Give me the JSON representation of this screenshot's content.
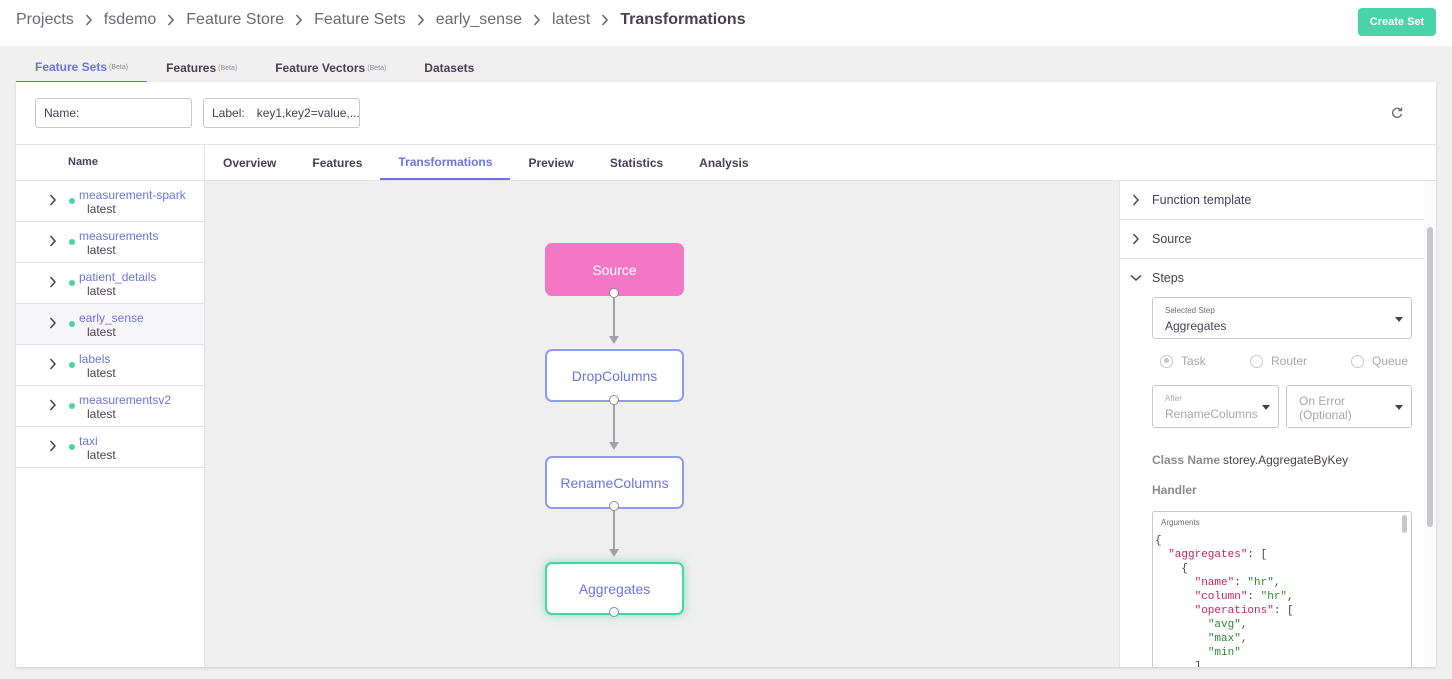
{
  "breadcrumbs": [
    "Projects",
    "fsdemo",
    "Feature Store",
    "Feature Sets",
    "early_sense",
    "latest",
    "Transformations"
  ],
  "header": {
    "create_label": "Create Set"
  },
  "top_tabs": [
    {
      "label": "Feature Sets",
      "beta": "(Beta)"
    },
    {
      "label": "Features",
      "beta": "(Beta)"
    },
    {
      "label": "Feature Vectors",
      "beta": "(Beta)"
    },
    {
      "label": "Datasets",
      "beta": ""
    }
  ],
  "filters": {
    "name_label": "Name:",
    "label_label": "Label:",
    "label_placeholder": "key1,key2=value,..."
  },
  "table": {
    "header": "Name",
    "rows": [
      {
        "name": "measurement-spark",
        "tag": "latest"
      },
      {
        "name": "measurements",
        "tag": "latest"
      },
      {
        "name": "patient_details",
        "tag": "latest"
      },
      {
        "name": "early_sense",
        "tag": "latest"
      },
      {
        "name": "labels",
        "tag": "latest"
      },
      {
        "name": "measurementsv2",
        "tag": "latest"
      },
      {
        "name": "taxi",
        "tag": "latest"
      }
    ]
  },
  "inner_tabs": [
    "Overview",
    "Features",
    "Transformations",
    "Preview",
    "Statistics",
    "Analysis"
  ],
  "graph": {
    "nodes": [
      "Source",
      "DropColumns",
      "RenameColumns",
      "Aggregates"
    ]
  },
  "panel": {
    "accordions": [
      "Function template",
      "Source",
      "Steps"
    ],
    "selected_step_label": "Selected Step",
    "selected_step_value": "Aggregates",
    "radios": [
      "Task",
      "Router",
      "Queue"
    ],
    "after_label": "After",
    "after_value": "RenameColumns",
    "on_error_value": "On Error (Optional)",
    "class_name_label": "Class Name",
    "class_name_value": "storey.AggregateByKey",
    "handler_label": "Handler",
    "arguments_label": "Arguments"
  },
  "colors": {
    "accent": "#6b74df",
    "success": "#49d3a6",
    "source_node": "#f477c6"
  }
}
